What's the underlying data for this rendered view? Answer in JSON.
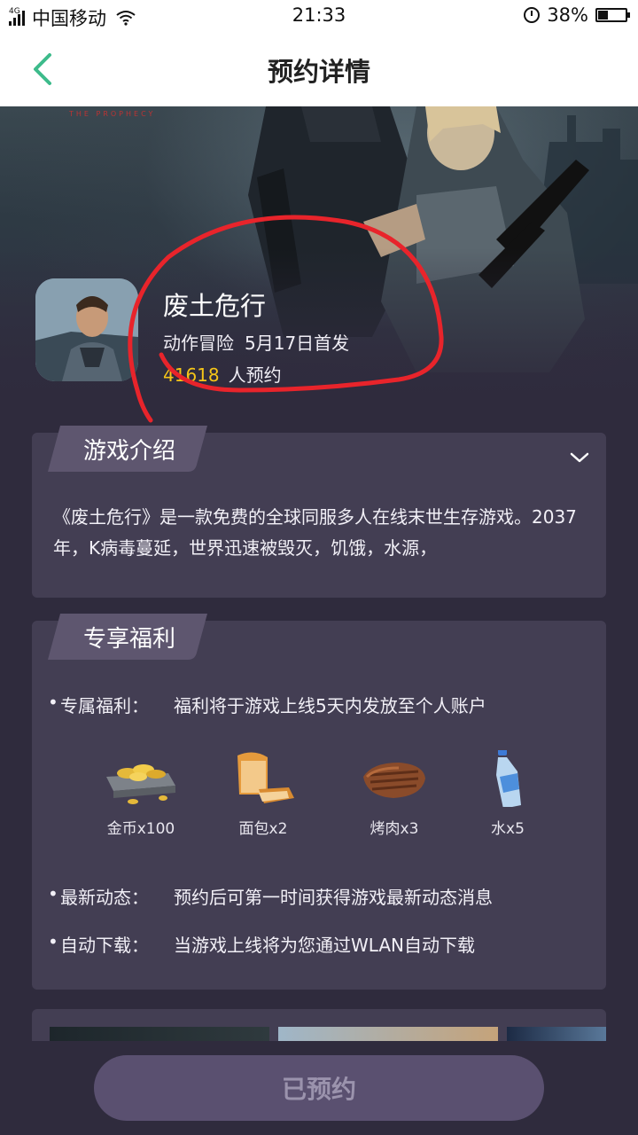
{
  "status_bar": {
    "network": "4G",
    "carrier": "中国移动",
    "time": "21:33",
    "battery": "38%",
    "battery_level": 0.38
  },
  "header": {
    "title": "预约详情"
  },
  "game": {
    "title": "废土危行",
    "genre": "动作冒险",
    "release": "5月17日首发",
    "reservation_count": "41618",
    "reservation_suffix": "人预约"
  },
  "intro": {
    "heading": "游戏介绍",
    "text": "《废土危行》是一款免费的全球同服多人在线末世生存游戏。2037年，K病毒蔓延，世界迅速被毁灭，饥饿，水源，"
  },
  "benefits": {
    "heading": "专享福利",
    "rows": [
      {
        "key": "专属福利：",
        "value": "福利将于游戏上线5天内发放至个人账户"
      },
      {
        "key": "最新动态：",
        "value": "预约后可第一时间获得游戏最新动态消息"
      },
      {
        "key": "自动下载：",
        "value": "当游戏上线将为您通过WLAN自动下载"
      }
    ],
    "rewards": [
      {
        "label": "金币x100",
        "icon": "gold-coins-icon"
      },
      {
        "label": "面包x2",
        "icon": "bread-icon"
      },
      {
        "label": "烤肉x3",
        "icon": "roast-meat-icon"
      },
      {
        "label": "水x5",
        "icon": "water-bottle-icon"
      }
    ]
  },
  "bottom": {
    "button_label": "已预约"
  },
  "colors": {
    "accent": "#3dbb8b",
    "background": "#2f2b3d",
    "card": "#433e53",
    "highlight": "#f5c518",
    "annotation": "#e8242b"
  }
}
